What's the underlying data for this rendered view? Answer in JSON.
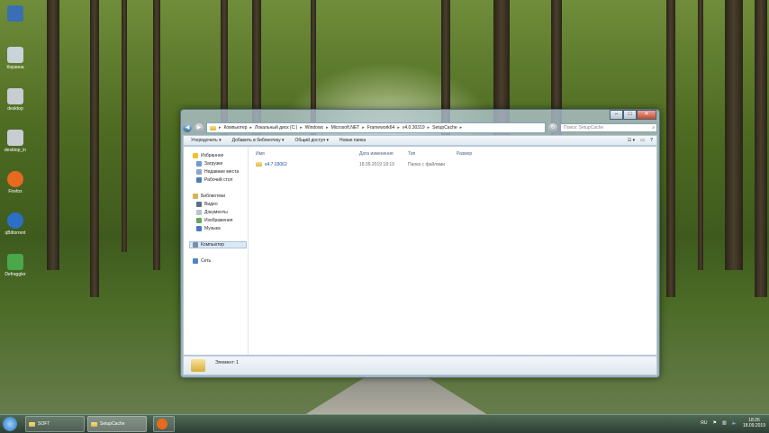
{
  "desktop": {
    "icons": [
      {
        "label": "",
        "color": "#3a6fb5"
      },
      {
        "label": "Корзина",
        "color": "#c9d3da"
      },
      {
        "label": "desktop",
        "color": "#c7cdd2"
      },
      {
        "label": "desktop_in",
        "color": "#c7cdd2"
      },
      {
        "label": "Firefox",
        "color": "#e66a1f"
      },
      {
        "label": "qBittorrent",
        "color": "#2b6fc6"
      },
      {
        "label": "Defraggler",
        "color": "#4aa84a"
      }
    ]
  },
  "window": {
    "controls": {
      "minimize": "–",
      "maximize": "□",
      "close": "✕"
    },
    "address": [
      "Компьютер",
      "Локальный диск (C:)",
      "Windows",
      "Microsoft.NET",
      "Framework64",
      "v4.0.30319",
      "SetupCache"
    ],
    "search_placeholder": "Поиск: SetupCache",
    "toolbar": {
      "organize": "Упорядочить ▾",
      "add_to_library": "Добавить в библиотеку ▾",
      "share": "Общий доступ ▾",
      "new_folder": "Новая папка"
    },
    "nav": {
      "favorites": "Избранное",
      "downloads": "Загрузки",
      "recent": "Недавние места",
      "desktop": "Рабочий стол",
      "libraries": "Библиотеки",
      "video": "Видео",
      "documents": "Документы",
      "images": "Изображения",
      "music": "Музыка",
      "computer": "Компьютер",
      "network": "Сеть"
    },
    "columns": {
      "name": "Имя",
      "date": "Дата изменения",
      "type": "Тип",
      "size": "Размер"
    },
    "files": [
      {
        "name": "v4.7.03062",
        "date": "18.09.2019 18:19",
        "type": "Папка с файлами",
        "size": ""
      }
    ],
    "status": "Элемент: 1"
  },
  "taskbar": {
    "buttons": [
      {
        "label": "SOFT"
      },
      {
        "label": "SetupCache"
      }
    ],
    "language": "RU",
    "time": "18:26",
    "date": "18.09.2019"
  }
}
